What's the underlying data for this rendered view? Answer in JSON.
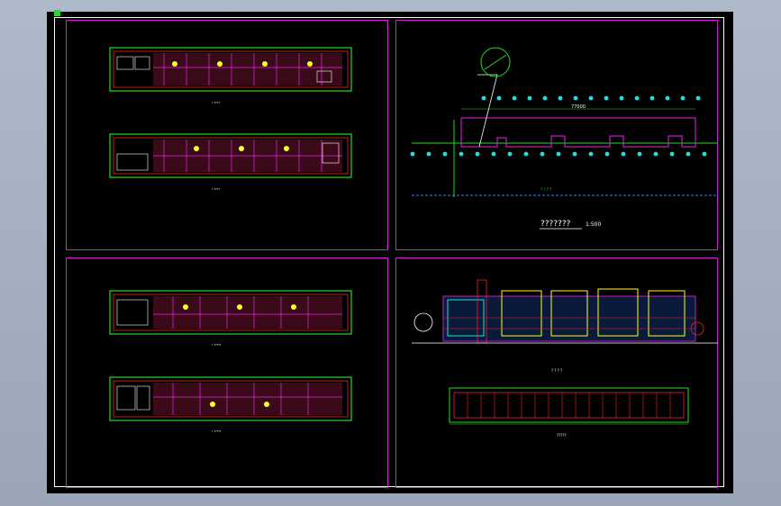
{
  "drawing": {
    "site_plan": {
      "dimension_label": "77000",
      "title": "???????",
      "scale": "1:500"
    },
    "colors": {
      "background": "#000000",
      "frame": "#ffffff",
      "panel_border": "#d020d0",
      "wall_green": "#22dd22",
      "wall_red": "#ee2222",
      "magenta": "#ee22ee",
      "cyan": "#22e0e0",
      "yellow": "#ffff22",
      "white": "#ffffff"
    }
  }
}
